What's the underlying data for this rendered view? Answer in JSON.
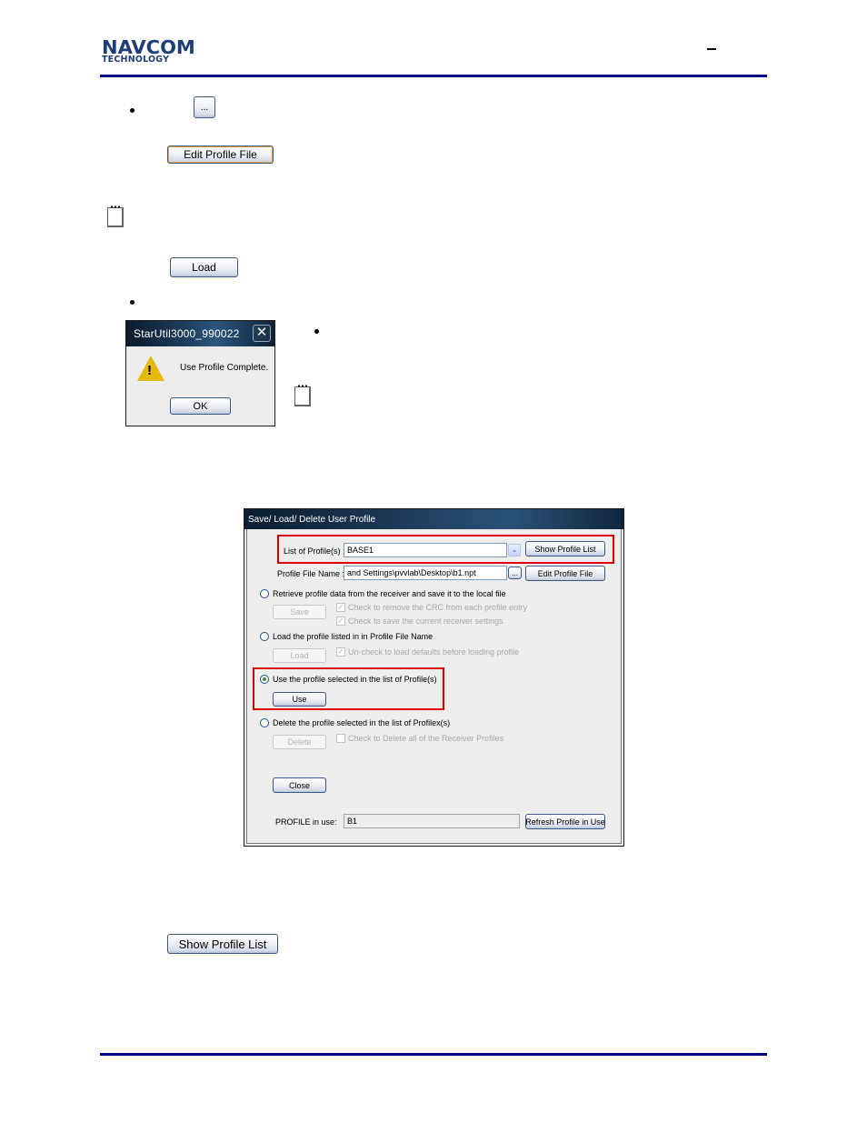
{
  "header": {
    "logo_line1": "NAVCOM",
    "logo_line2": "TECHNOLOGY",
    "dash": "–"
  },
  "colors": {
    "rule": "#000080",
    "highlight": "#e00000",
    "logo": "#1f3d7a"
  },
  "inline_buttons": {
    "browse_label": "...",
    "edit_profile_file_label": "Edit Profile File",
    "load_label": "Load",
    "show_profile_list_label": "Show Profile List"
  },
  "message_dialog": {
    "title": "StarUtil3000_990022",
    "close_glyph": "✕",
    "message": "Use Profile Complete.",
    "ok_label": "OK",
    "icon": "warning-icon"
  },
  "profile_dialog": {
    "title": "Save/ Load/ Delete User Profile",
    "list_label": "List of Profile(s) :",
    "list_value": "BASE1",
    "show_list_label": "Show Profile List",
    "file_name_label": "Profile File Name :",
    "file_name_value": "and Settings\\pvvlab\\Desktop\\b1.npt",
    "browse_label": "...",
    "edit_file_label": "Edit Profile File",
    "options": [
      {
        "label": "Retrieve profile data from the receiver and save it to the local file",
        "selected": false,
        "button": "Save",
        "button_enabled": false,
        "checks": [
          {
            "label": "Check to remove the CRC from each profile entry",
            "checked": true,
            "enabled": false
          },
          {
            "label": "Check to save the current receiver settings",
            "checked": true,
            "enabled": false
          }
        ]
      },
      {
        "label": "Load the profile listed in in Profile File Name",
        "selected": false,
        "button": "Load",
        "button_enabled": false,
        "checks": [
          {
            "label": "Un-check to load defaults before loading profile",
            "checked": true,
            "enabled": false
          }
        ]
      },
      {
        "label": "Use the profile selected in the list of Profile(s)",
        "selected": true,
        "button": "Use",
        "button_enabled": true,
        "checks": []
      },
      {
        "label": "Delete the profile selected in the list of Profilex(s)",
        "selected": false,
        "button": "Delete",
        "button_enabled": false,
        "checks": [
          {
            "label": "Check to Delete all of the Receiver Profiles",
            "checked": false,
            "enabled": false
          }
        ]
      }
    ],
    "close_label": "Close",
    "profile_in_use_label": "PROFILE in use:",
    "profile_in_use_value": "B1",
    "refresh_label": "Refresh Profile in Use",
    "check_glyph": "✓"
  }
}
